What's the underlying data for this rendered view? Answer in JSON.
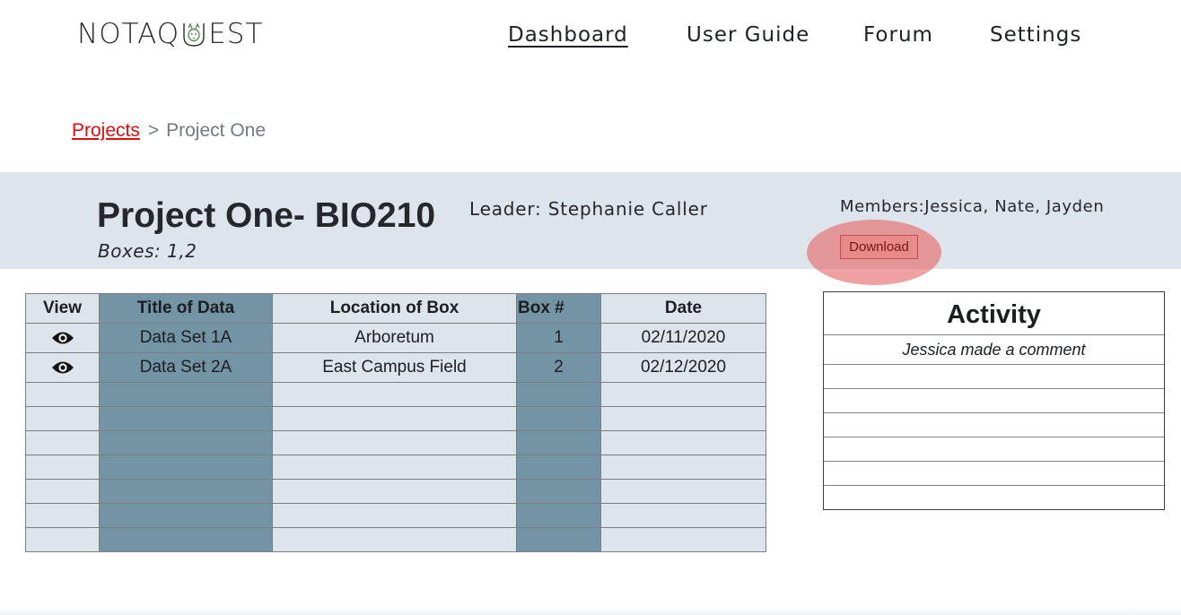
{
  "header": {
    "logo_left": "NOTAQ",
    "logo_right": "EST",
    "logo_icon": "creature-u-icon",
    "nav": [
      {
        "label": "Dashboard",
        "active": true
      },
      {
        "label": "User Guide",
        "active": false
      },
      {
        "label": "Forum",
        "active": false
      },
      {
        "label": "Settings",
        "active": false
      }
    ]
  },
  "breadcrumb": {
    "link": "Projects",
    "separator": ">",
    "current": "Project One"
  },
  "project": {
    "title": "Project One- BIO210",
    "boxes": "Boxes: 1,2",
    "leader": "Leader: Stephanie Caller",
    "members": "Members:Jessica, Nate, Jayden",
    "download_label": "Download"
  },
  "table": {
    "columns": [
      "View",
      "Title of Data",
      "Location of Box",
      "Box #",
      "Date"
    ],
    "rows": [
      {
        "view_icon": "eye-icon",
        "title": "Data Set 1A",
        "location": "Arboretum",
        "box": "1",
        "date": "02/11/2020"
      },
      {
        "view_icon": "eye-icon",
        "title": "Data Set 2A",
        "location": "East Campus Field",
        "box": "2",
        "date": "02/12/2020"
      }
    ],
    "empty_rows": 7
  },
  "activity": {
    "title": "Activity",
    "items": [
      "Jessica made a comment",
      "",
      "",
      "",
      "",
      "",
      ""
    ]
  },
  "colors": {
    "band": "#dee4eb",
    "dark_column": "#7394a4",
    "breadcrumb_link": "#e00d0d",
    "highlight": "#e56666"
  }
}
